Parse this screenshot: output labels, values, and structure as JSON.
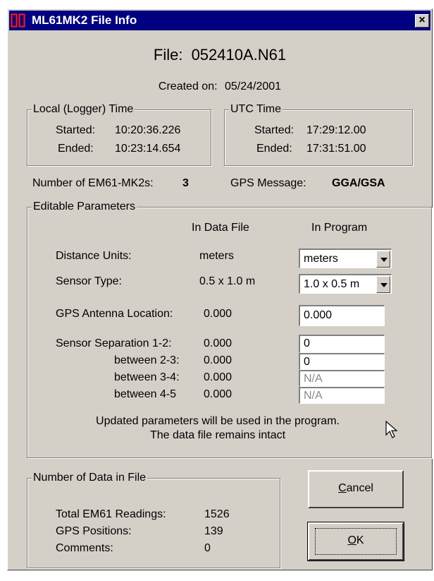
{
  "window": {
    "title": "ML61MK2 File Info",
    "close_symbol": "×"
  },
  "file": {
    "heading_label": "File:",
    "name": "052410A.N61",
    "created_label": "Created on:",
    "created_date": "05/24/2001"
  },
  "local_time": {
    "legend": "Local (Logger) Time",
    "started_label": "Started:",
    "started": "10:20:36.226",
    "ended_label": "Ended:",
    "ended": "10:23:14.654"
  },
  "utc_time": {
    "legend": "UTC Time",
    "started_label": "Started:",
    "started": "17:29:12.00",
    "ended_label": "Ended:",
    "ended": "17:31:51.00"
  },
  "summary": {
    "num_em61_label": "Number of EM61-MK2s:",
    "num_em61": "3",
    "gps_msg_label": "GPS Message:",
    "gps_msg": "GGA/GSA"
  },
  "editable": {
    "legend": "Editable Parameters",
    "col_data_file": "In Data File",
    "col_program": "In Program",
    "distance_label": "Distance Units:",
    "distance_file": "meters",
    "distance_program": "meters",
    "sensor_label": "Sensor Type:",
    "sensor_file": "0.5 x 1.0 m",
    "sensor_program": "1.0 x 0.5 m",
    "antenna_label": "GPS Antenna Location:",
    "antenna_file": "0.000",
    "antenna_program": "0.000",
    "sep12_label": "Sensor Separation 1-2:",
    "sep12_file": "0.000",
    "sep12_program": "0",
    "sep23_label": "between 2-3:",
    "sep23_file": "0.000",
    "sep23_program": "0",
    "sep34_label": "between 3-4:",
    "sep34_file": "0.000",
    "sep34_program": "N/A",
    "sep45_label": "between 4-5",
    "sep45_file": "0.000",
    "sep45_program": "N/A",
    "note_line1": "Updated parameters will be used in the program.",
    "note_line2": "The data file remains intact"
  },
  "data_count": {
    "legend": "Number of Data in File",
    "readings_label": "Total EM61 Readings:",
    "readings": "1526",
    "gps_label": "GPS Positions:",
    "gps": "139",
    "comments_label": "Comments:",
    "comments": "0"
  },
  "buttons": {
    "cancel_hotkey": "C",
    "cancel_rest": "ancel",
    "ok_hotkey": "O",
    "ok_rest": "K"
  }
}
